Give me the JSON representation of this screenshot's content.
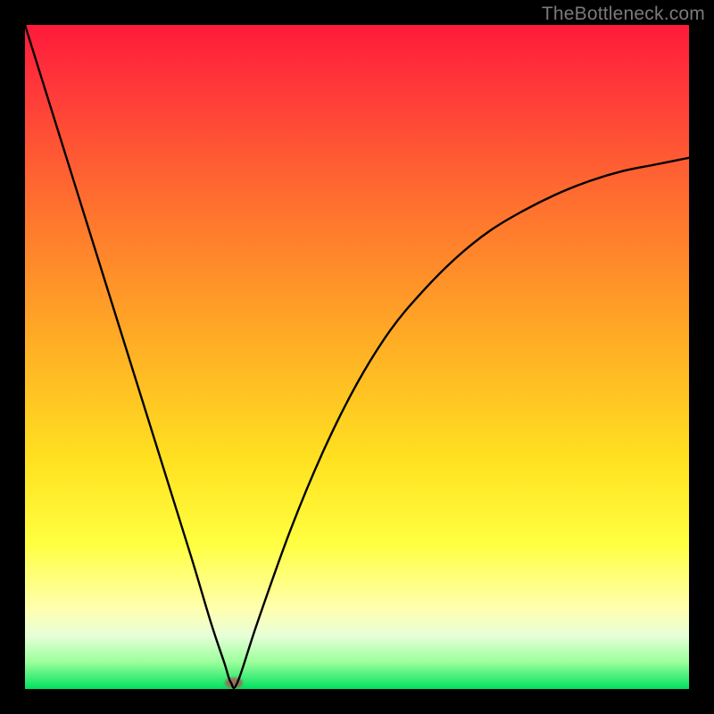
{
  "watermark": {
    "text": "TheBottleneck.com"
  },
  "colors": {
    "gradient_top": "#ff1a3a",
    "gradient_bottom": "#00e060",
    "frame_bg": "#000000",
    "curve_stroke": "#000000",
    "marker_fill": "rgba(180,80,80,0.75)"
  },
  "chart_data": {
    "type": "line",
    "title": "",
    "xlabel": "",
    "ylabel": "",
    "xlim": [
      0,
      100
    ],
    "ylim": [
      0,
      100
    ],
    "grid": false,
    "legend": false,
    "annotations": [],
    "series": [
      {
        "name": "curve",
        "x": [
          0,
          5,
          10,
          15,
          20,
          25,
          28,
          30,
          31,
          32,
          35,
          40,
          45,
          50,
          55,
          60,
          65,
          70,
          75,
          80,
          85,
          90,
          95,
          100
        ],
        "values": [
          100,
          84,
          68,
          52,
          36,
          20,
          10,
          4,
          1,
          1,
          10,
          24,
          36,
          46,
          54,
          60,
          65,
          69,
          72,
          74.5,
          76.5,
          78,
          79,
          80
        ]
      }
    ],
    "marker": {
      "x": 31.5,
      "y": 1
    }
  }
}
